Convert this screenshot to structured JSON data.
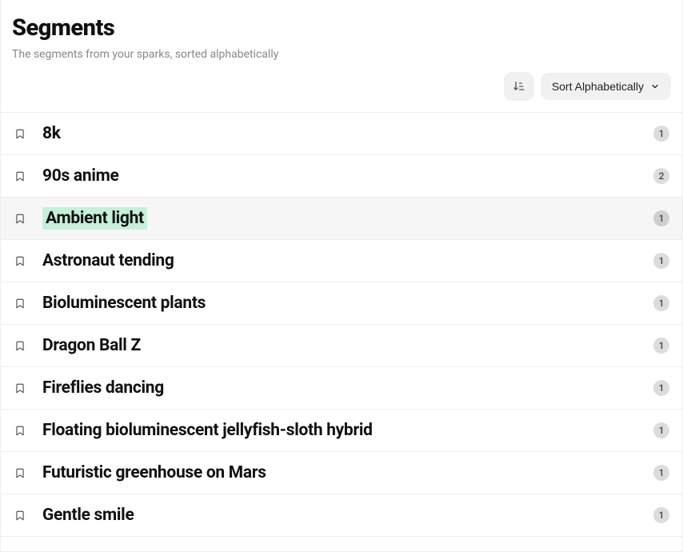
{
  "header": {
    "title": "Segments",
    "subtitle": "The segments from your sparks, sorted alphabetically"
  },
  "controls": {
    "sort_label": "Sort Alphabetically"
  },
  "segments": [
    {
      "label": "8k",
      "count": "1",
      "selected": false
    },
    {
      "label": "90s anime",
      "count": "2",
      "selected": false
    },
    {
      "label": "Ambient light",
      "count": "1",
      "selected": true
    },
    {
      "label": "Astronaut tending",
      "count": "1",
      "selected": false
    },
    {
      "label": "Bioluminescent plants",
      "count": "1",
      "selected": false
    },
    {
      "label": "Dragon Ball Z",
      "count": "1",
      "selected": false
    },
    {
      "label": "Fireflies dancing",
      "count": "1",
      "selected": false
    },
    {
      "label": "Floating bioluminescent jellyfish-sloth hybrid",
      "count": "1",
      "selected": false
    },
    {
      "label": "Futuristic greenhouse on Mars",
      "count": "1",
      "selected": false
    },
    {
      "label": "Gentle smile",
      "count": "1",
      "selected": false
    }
  ]
}
